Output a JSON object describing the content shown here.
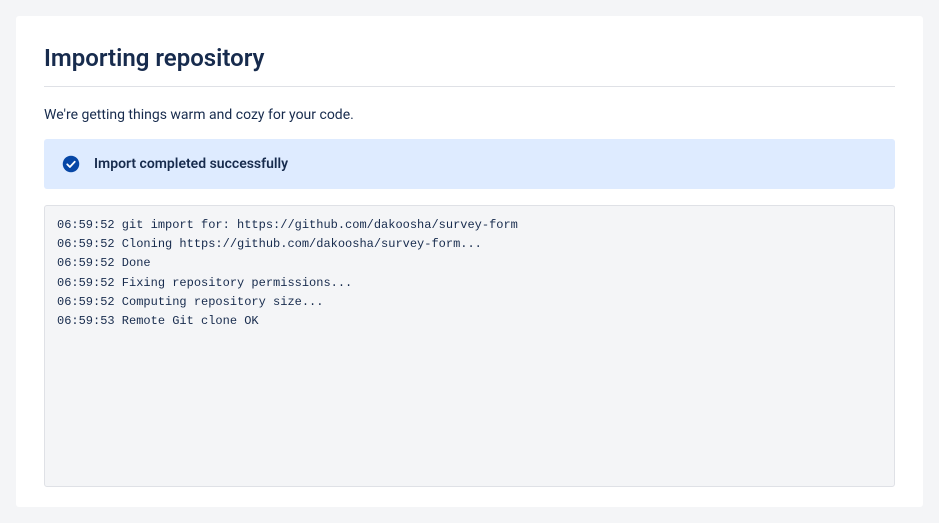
{
  "header": {
    "title": "Importing repository",
    "subtitle": "We're getting things warm and cozy for your code."
  },
  "status": {
    "icon": "check-circle-icon",
    "message": "Import completed successfully"
  },
  "log": {
    "lines": [
      "06:59:52 git import for: https://github.com/dakoosha/survey-form",
      "06:59:52 Cloning https://github.com/dakoosha/survey-form...",
      "06:59:52 Done",
      "06:59:52 Fixing repository permissions...",
      "06:59:52 Computing repository size...",
      "06:59:53 Remote Git clone OK"
    ]
  }
}
